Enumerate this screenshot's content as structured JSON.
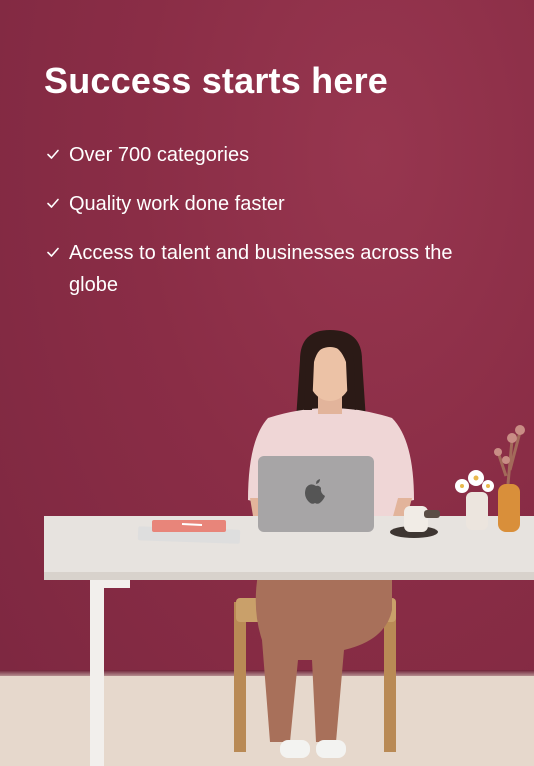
{
  "promo": {
    "headline": "Success starts here",
    "features": [
      {
        "text": "Over 700 categories",
        "icon": "check-icon"
      },
      {
        "text": "Quality work done faster",
        "icon": "check-icon"
      },
      {
        "text": "Access to talent and businesses across the globe",
        "icon": "check-icon"
      }
    ]
  },
  "colors": {
    "background": "#8a2d46",
    "text": "#ffffff",
    "floor": "#e6d8cc"
  }
}
